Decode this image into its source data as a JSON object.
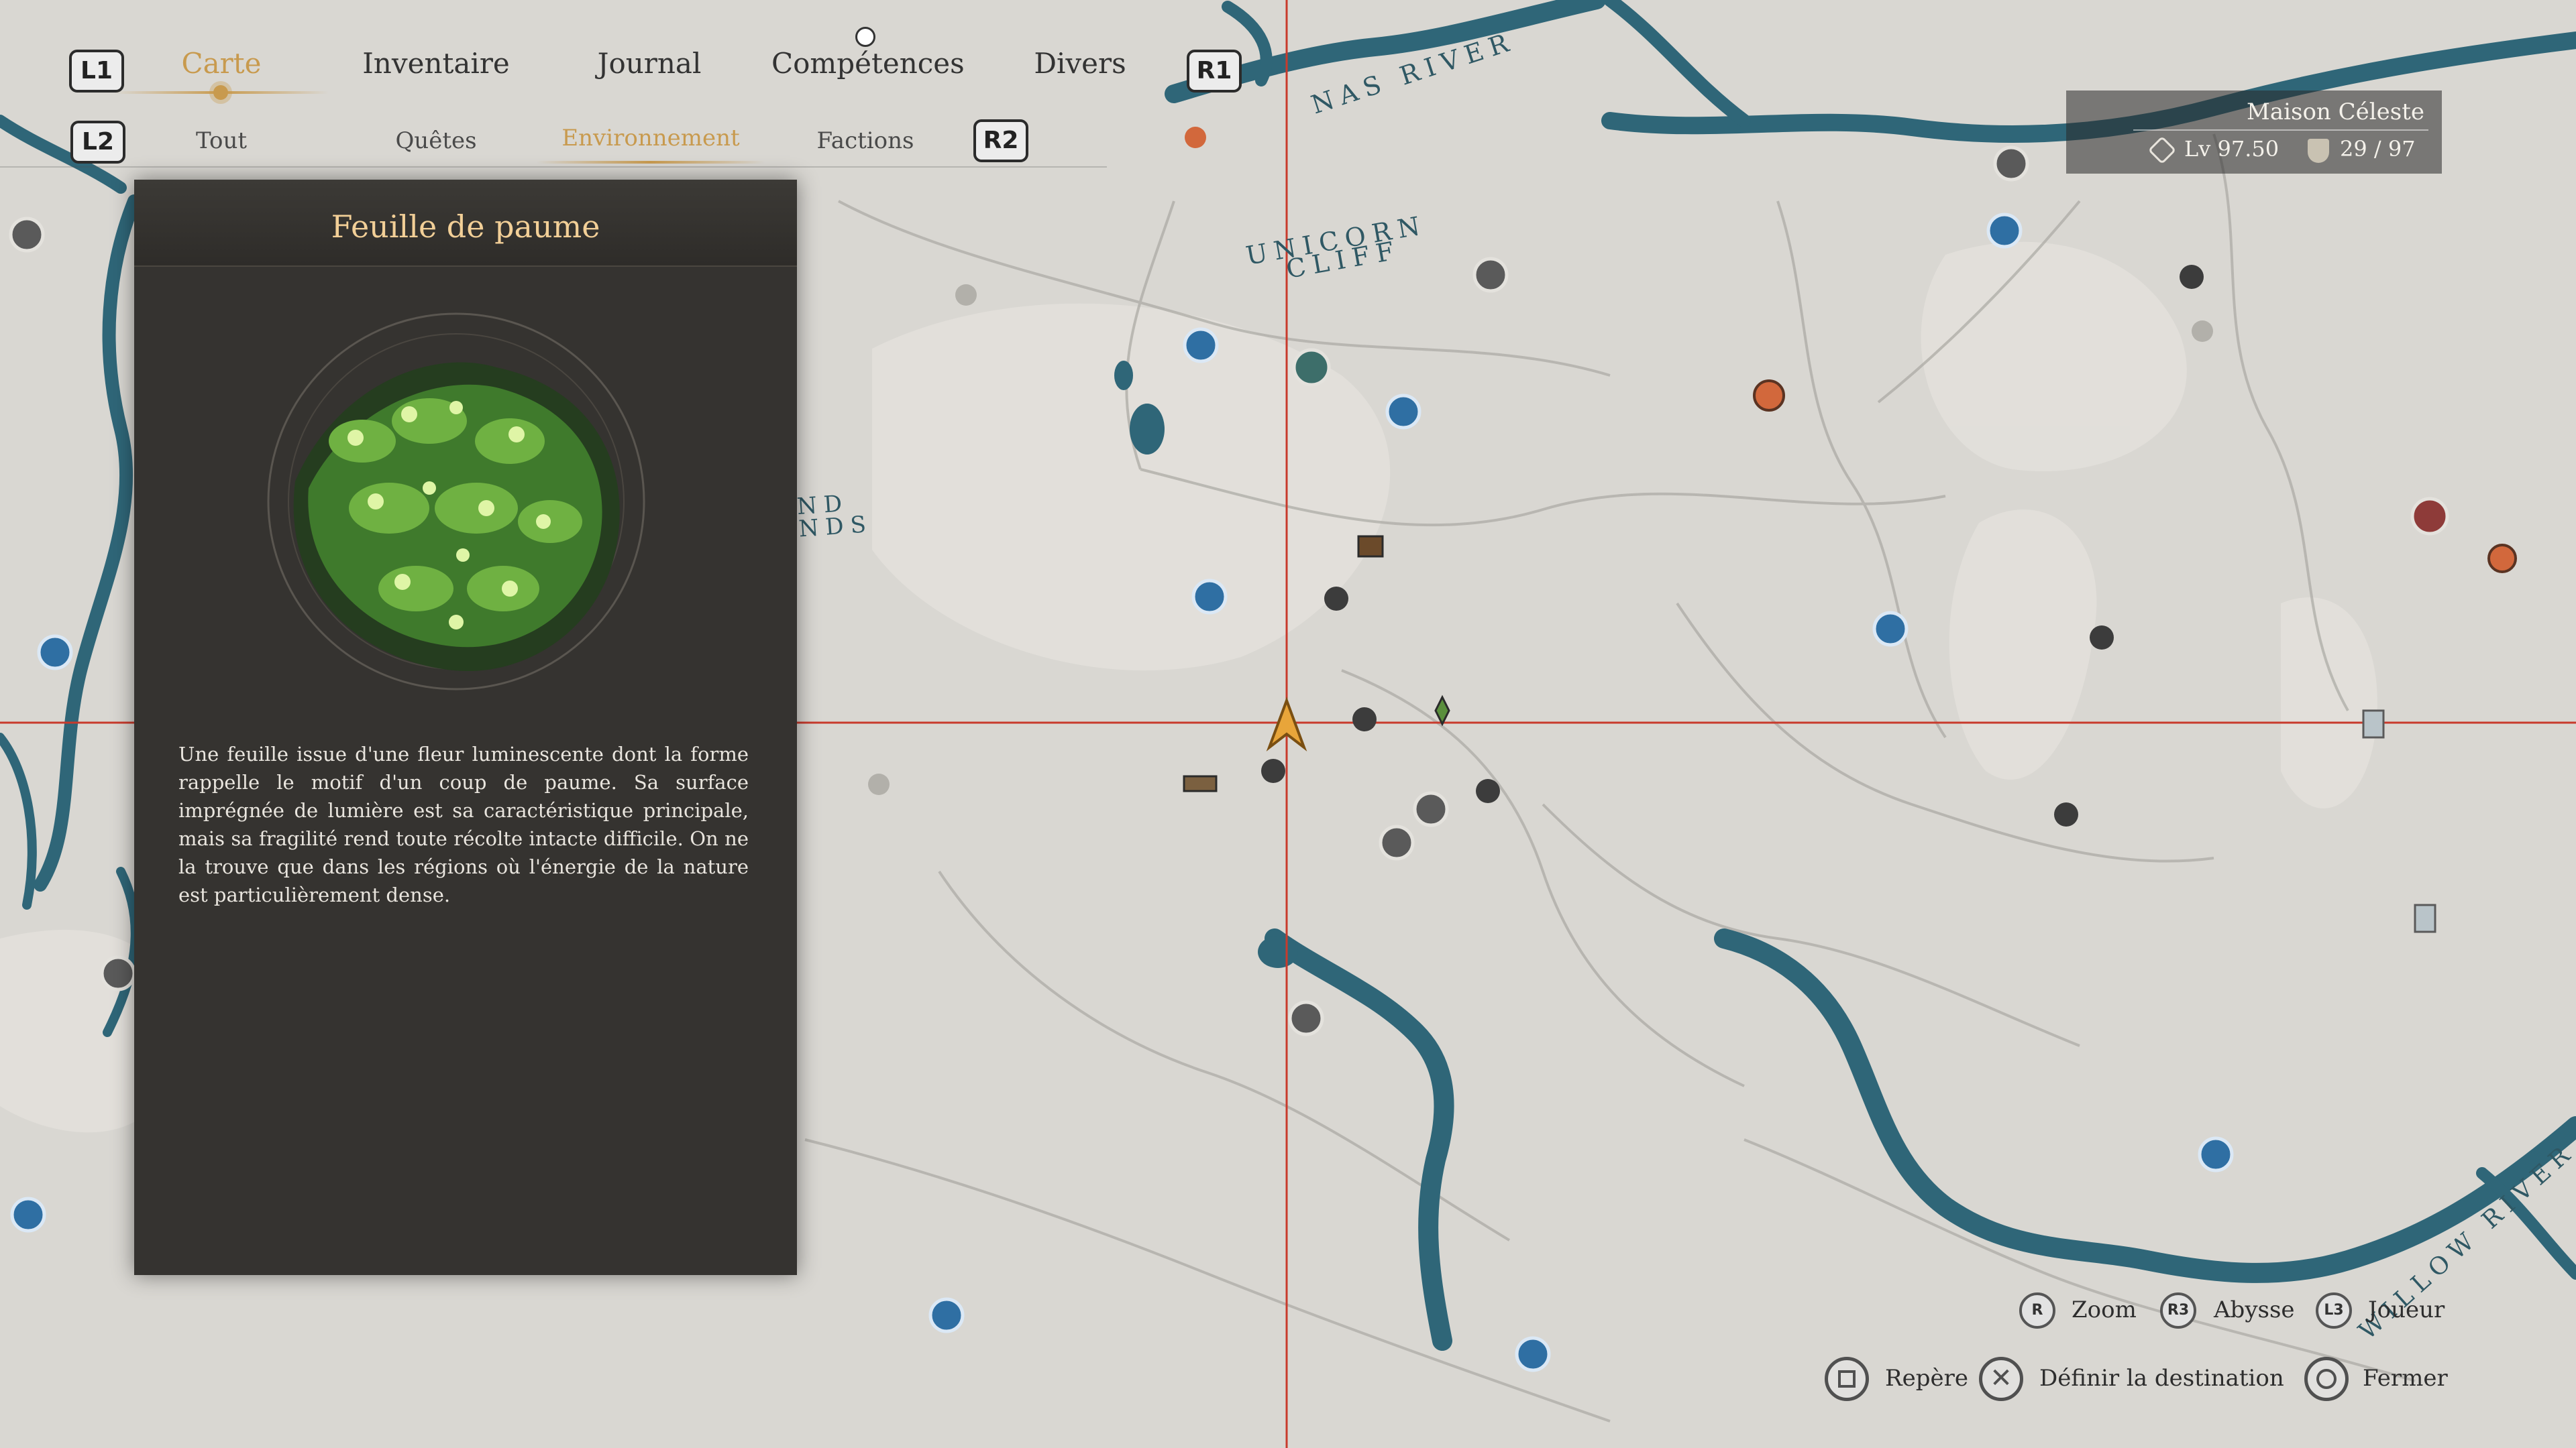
{
  "nav": {
    "left_shoulder": "L1",
    "right_shoulder": "R1",
    "tabs": [
      {
        "label": "Carte",
        "active": true
      },
      {
        "label": "Inventaire",
        "active": false
      },
      {
        "label": "Journal",
        "active": false
      },
      {
        "label": "Compétences",
        "active": false
      },
      {
        "label": "Divers",
        "active": false
      }
    ]
  },
  "subnav": {
    "left_shoulder": "L2",
    "right_shoulder": "R2",
    "tabs": [
      {
        "label": "Tout",
        "active": false
      },
      {
        "label": "Quêtes",
        "active": false
      },
      {
        "label": "Environnement",
        "active": true
      },
      {
        "label": "Factions",
        "active": false
      }
    ]
  },
  "map_labels": {
    "nas_river": "NAS RIVER",
    "unicorn": "UNICORN",
    "cliff": "CLIFF",
    "hernand": "HERNAND",
    "highlands": "HIGHLANDS",
    "willow_river": "WILLOW RIVER"
  },
  "panel": {
    "title": "Feuille de paume",
    "description": "Une feuille issue d'une fleur luminescente dont la forme rappelle le motif d'un coup de paume. Sa surface imprégnée de lumière est sa caractéristique principale, mais sa fragilité rend toute récolte intacte difficile. On ne la trouve que dans les régions où l'énergie de la nature est particulièrement dense."
  },
  "status": {
    "location": "Maison Céleste",
    "level": "Lv 97.50",
    "count": "29 / 97"
  },
  "controls": {
    "zoom_key": "R",
    "zoom": "Zoom",
    "abyss_key": "R3",
    "abyss": "Abysse",
    "player_key": "L3",
    "player": "Joueur",
    "marker": "Repère",
    "destination": "Définir la destination",
    "close": "Fermer"
  },
  "colors": {
    "water": "#2f6678",
    "land": "#d8d6d1",
    "accent": "#c89a4e",
    "crosshair": "#c83a2c"
  }
}
